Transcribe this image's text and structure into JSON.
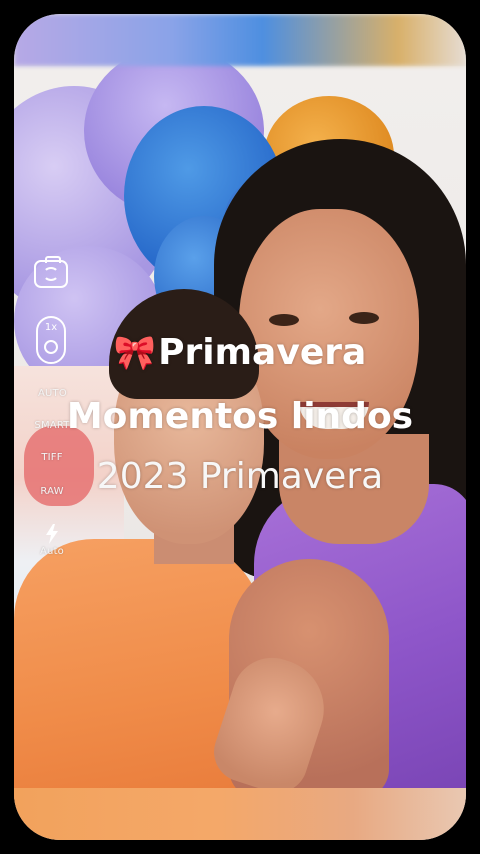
{
  "camera_controls": {
    "zoom_label": "1x",
    "mode_auto": "AUTO",
    "mode_smart": "SMART",
    "format_tiff": "TIFF",
    "format_raw": "RAW",
    "flash_label": "Auto",
    "flip_camera_icon": "camera-flip-icon",
    "flash_icon": "lightning-icon"
  },
  "caption": {
    "line1_emoji": "🎀",
    "line1_text": "Primavera",
    "line2_text": "Momentos lindos",
    "line3_text": "2023 Primavera"
  },
  "colors": {
    "background": "#000000",
    "caption_text": "#ffffff"
  }
}
